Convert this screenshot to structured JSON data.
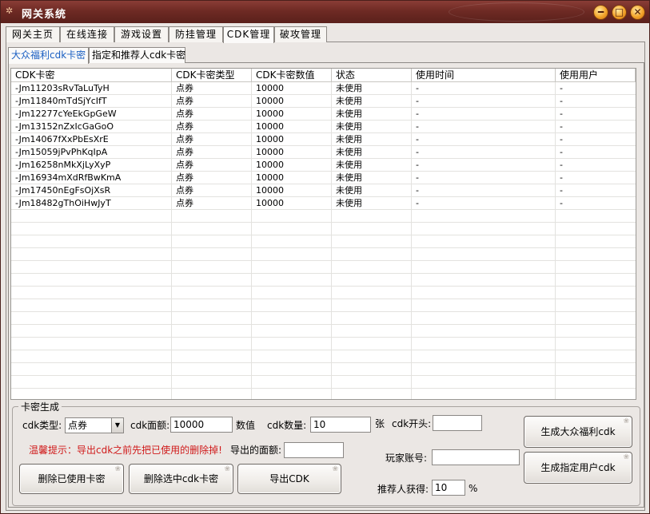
{
  "window": {
    "title": "网关系统",
    "app_icon": "app-icon",
    "controls": [
      {
        "name": "minimize-button",
        "glyph": "━"
      },
      {
        "name": "maximize-button",
        "glyph": "□"
      },
      {
        "name": "close-button",
        "glyph": "✕"
      }
    ]
  },
  "main_tabs": [
    {
      "label": "网关主页",
      "active": false
    },
    {
      "label": "在线连接",
      "active": false
    },
    {
      "label": "游戏设置",
      "active": false
    },
    {
      "label": "防挂管理",
      "active": false
    },
    {
      "label": "CDK管理",
      "active": true
    },
    {
      "label": "破攻管理",
      "active": false
    }
  ],
  "sub_tabs": [
    {
      "label": "大众福利cdk卡密",
      "active": true
    },
    {
      "label": "指定和推荐人cdk卡密",
      "active": false
    }
  ],
  "table": {
    "columns": [
      "CDK卡密",
      "CDK卡密类型",
      "CDK卡密数值",
      "状态",
      "使用时间",
      "使用用户"
    ],
    "rows": [
      [
        "-Jm11203sRvTaLuTyH",
        "点券",
        "10000",
        "未使用",
        "-",
        "-"
      ],
      [
        "-Jm11840mTdSjYcIfT",
        "点券",
        "10000",
        "未使用",
        "-",
        "-"
      ],
      [
        "-Jm12277cYeEkGpGeW",
        "点券",
        "10000",
        "未使用",
        "-",
        "-"
      ],
      [
        "-Jm13152nZxIcGaGoO",
        "点券",
        "10000",
        "未使用",
        "-",
        "-"
      ],
      [
        "-Jm14067fXxPbEsXrE",
        "点券",
        "10000",
        "未使用",
        "-",
        "-"
      ],
      [
        "-Jm15059jPvPhKqIpA",
        "点券",
        "10000",
        "未使用",
        "-",
        "-"
      ],
      [
        "-Jm16258nMkXjLyXyP",
        "点券",
        "10000",
        "未使用",
        "-",
        "-"
      ],
      [
        "-Jm16934mXdRfBwKmA",
        "点券",
        "10000",
        "未使用",
        "-",
        "-"
      ],
      [
        "-Jm17450nEgFsOjXsR",
        "点券",
        "10000",
        "未使用",
        "-",
        "-"
      ],
      [
        "-Jm18482gThOiHwJyT",
        "点券",
        "10000",
        "未使用",
        "-",
        "-"
      ]
    ]
  },
  "generator": {
    "group_title": "卡密生成",
    "cdk_type_label": "cdk类型:",
    "cdk_type_value": "点券",
    "cdk_amount_label": "cdk面额:",
    "cdk_amount_value": "10000",
    "amount_unit": "数值",
    "cdk_count_label": "cdk数量:",
    "cdk_count_value": "10",
    "count_unit": "张",
    "cdk_prefix_label": "cdk开头:",
    "cdk_prefix_value": "",
    "warning": "温馨提示：导出cdk之前先把已使用的删除掉!",
    "exported_amount_label": "导出的面额:",
    "exported_amount_value": "",
    "player_account_label": "玩家账号:",
    "player_account_value": "",
    "referrer_label": "推荐人获得:",
    "referrer_value": "10",
    "referrer_unit": "%",
    "btn_delete_used": "删除已使用卡密",
    "btn_delete_selected": "删除选中cdk卡密",
    "btn_export": "导出CDK",
    "btn_generate_public": "生成大众福利cdk",
    "btn_generate_user": "生成指定用户cdk"
  },
  "colors": {
    "titlebar": "#6e2a24",
    "warning_text": "#d01a1a",
    "active_subtab_text": "#1a5fc2"
  }
}
